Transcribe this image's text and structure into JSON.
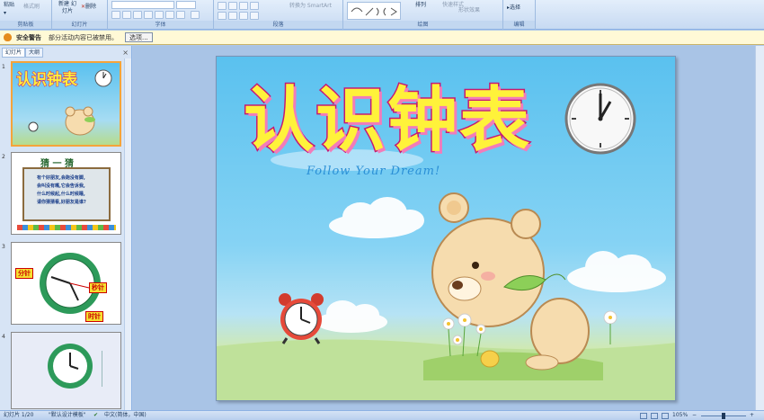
{
  "ribbon": {
    "groups": [
      {
        "label": "剪贴板",
        "buttons": [
          "粘贴",
          "格式刷"
        ]
      },
      {
        "label": "幻灯片",
        "buttons": [
          "新建 幻灯片",
          "删除"
        ]
      },
      {
        "label": "字体"
      },
      {
        "label": "段落",
        "buttons": [
          "转换为 SmartArt"
        ]
      },
      {
        "label": "绘图",
        "buttons": [
          "排列",
          "快速样式",
          "形状效果"
        ]
      },
      {
        "label": "编辑",
        "buttons": [
          "选择"
        ]
      }
    ]
  },
  "security_bar": {
    "title": "安全警告",
    "message": "部分活动内容已被禁用。",
    "options_button": "选项..."
  },
  "panel": {
    "tabs": [
      "幻灯片",
      "大纲"
    ],
    "close": "×",
    "thumbnails": [
      {
        "num": "1",
        "caption": "认识钟表"
      },
      {
        "num": "2",
        "caption": "猜 一 猜",
        "riddle": [
          "有个好朋友,会跑没有脚,",
          "会叫没有嘴,它会告诉我,",
          "什么时候起,什么时候睡,",
          "请你猜猜看,好朋友是谁?"
        ]
      },
      {
        "num": "3",
        "labels": [
          "分针",
          "秒针",
          "时针"
        ]
      },
      {
        "num": "4"
      }
    ]
  },
  "slide": {
    "title": "认识钟表",
    "subtitle": "Follow Your Dream!",
    "clock_time_hour": 1,
    "clock_time_minute": 0
  },
  "status": {
    "slide_pos": "幻灯片 1/20",
    "theme": "\"默认设计模板\"",
    "language": "中文(简体，中国)",
    "zoom": "105%"
  },
  "colors": {
    "title_fill": "#fff23a",
    "title_stroke": "#c61874",
    "sky": "#5ac1ef",
    "grass": "#a8d37a"
  }
}
